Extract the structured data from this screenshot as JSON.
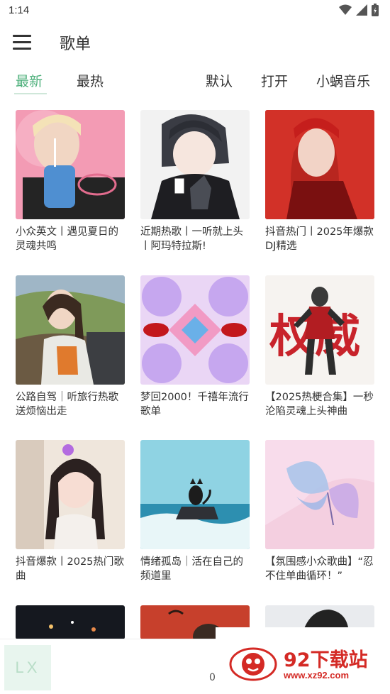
{
  "status_bar": {
    "time": "1:14"
  },
  "app_bar": {
    "title": "歌单"
  },
  "tabs": {
    "newest": "最新",
    "hottest": "最热",
    "default": "默认",
    "open": "打开",
    "source": "小蜗音乐"
  },
  "playlists": [
    {
      "title": "小众英文丨遇见夏日的灵魂共鸣"
    },
    {
      "title": "近期热歌丨一听就上头丨阿玛特拉斯!"
    },
    {
      "title": "抖音热门丨2025年爆款DJ精选"
    },
    {
      "title": "公路自驾｜听旅行热歌送烦恼出走"
    },
    {
      "title": "梦回2000！千禧年流行歌单"
    },
    {
      "title": "【2025热梗合集】一秒沦陷灵魂上头神曲"
    },
    {
      "title": "抖音爆款丨2025热门歌曲"
    },
    {
      "title": "情绪孤岛｜活在自己的频道里"
    },
    {
      "title": "【氛围感小众歌曲】“忍不住单曲循环！”"
    }
  ],
  "cover_text": {
    "quanwei": "权威"
  },
  "player": {
    "logo": "LX",
    "progress_fragment": "0"
  },
  "watermark": {
    "main": "92下载站",
    "sub": "www.xz92.com"
  }
}
